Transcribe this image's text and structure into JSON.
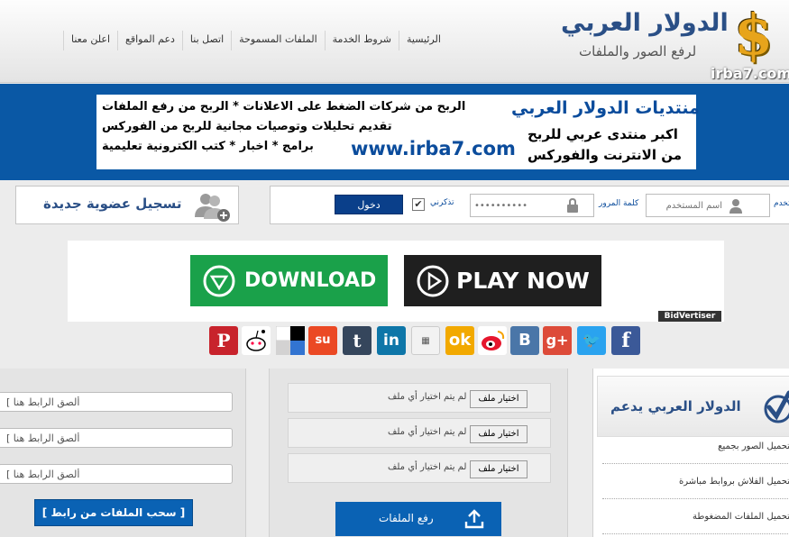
{
  "nav": {
    "items": [
      "الرئيسية",
      "شروط الخدمة",
      "الملفات المسموحة",
      "اتصل بنا",
      "دعم المواقع",
      "اعلن معنا"
    ]
  },
  "logo": {
    "title": "الدولار العربي",
    "subtitle": "لرفع الصور والملفات",
    "domain": "irba7.com",
    "symbol": "$"
  },
  "banner": {
    "forums_title": "منتديات الدولار العربي",
    "line1": "اكبر منتدى عربي للربح",
    "line2": "من الانترنت والفوركس",
    "text1": "الربح من شركات الضغط على الاعلانات * الربح من رفع الملفات",
    "text2": "تقديم تحليلات وتوصيات مجانية للربح من الفوركس",
    "text3": "برامج * اخبار * كتب الكترونية تعليمية",
    "url": "www.irba7.com"
  },
  "login": {
    "register_label": "تسجيل عضوية جديدة",
    "user_label": "اسم المستخدم",
    "user_placeholder": "اسم المستخدم",
    "pass_label": "كلمة المرور",
    "pass_placeholder": "••••••••••",
    "remember_label": "تذكرني",
    "remember_checked": "✔",
    "login_button": "دخول"
  },
  "ad": {
    "download_label": "DOWNLOAD",
    "play_label": "PLAY NOW",
    "badge": "BidVertiser"
  },
  "social": [
    "P",
    "reddit",
    "del",
    "su",
    "t",
    "in",
    "digg",
    "ok",
    "weibo",
    "B",
    "g+",
    "twitter",
    "f"
  ],
  "url_upload": {
    "rows": [
      "[ ألصق الرابط هنا",
      "[ ألصق الرابط هنا",
      "[ ألصق الرابط هنا"
    ],
    "pull_button": "[ سحب الملفات من رابط ]"
  },
  "file_upload": {
    "rows": [
      {
        "button": "اختيار ملف",
        "status": "لم يتم اختيار أي ملف"
      },
      {
        "button": "اختيار ملف",
        "status": "لم يتم اختيار أي ملف"
      },
      {
        "button": "اختيار ملف",
        "status": "لم يتم اختيار أي ملف"
      }
    ],
    "upload_button": "رفع الملفات"
  },
  "support": {
    "title": "الدولار العربي يدعم",
    "items": [
      "تحميل الصور بجميع",
      "تحميل الفلاش بروابط مباشرة",
      "تحميل الملفات المضغوطة"
    ]
  },
  "colors": {
    "brand_blue": "#0a58a5",
    "title_blue": "#2a4f86",
    "download_green": "#1aa14a",
    "dollar_gold": "#e7a41b"
  }
}
